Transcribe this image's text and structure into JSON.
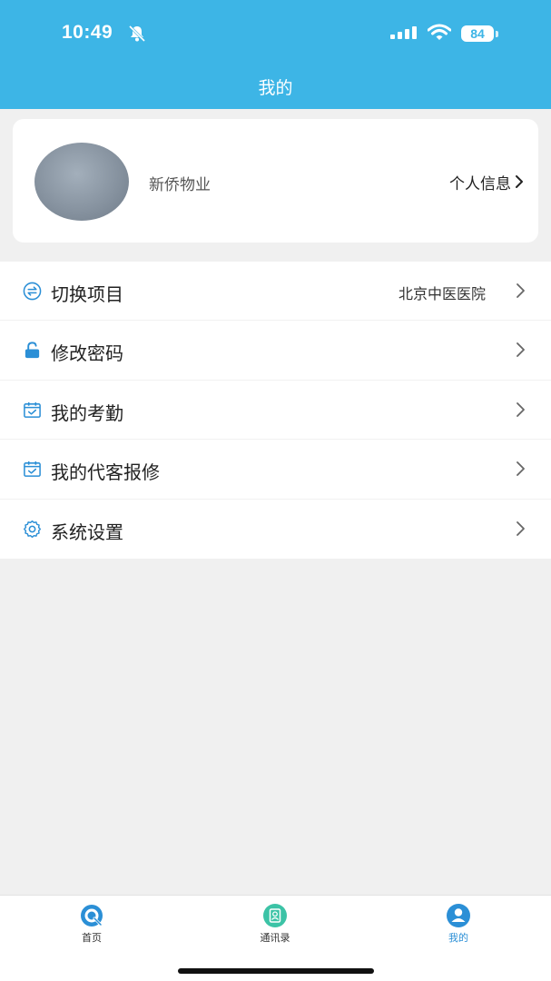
{
  "status_bar": {
    "time": "10:49",
    "battery": "84"
  },
  "header": {
    "title": "我的"
  },
  "profile": {
    "name": "新侨物业",
    "link_label": "个人信息"
  },
  "menu": {
    "items": [
      {
        "label": "切换项目",
        "value": "北京中医医院",
        "icon": "switch-icon"
      },
      {
        "label": "修改密码",
        "icon": "lock-icon"
      },
      {
        "label": "我的考勤",
        "icon": "calendar-check-icon"
      },
      {
        "label": "我的代客报修",
        "icon": "calendar-check-icon"
      },
      {
        "label": "系统设置",
        "icon": "gear-icon"
      }
    ]
  },
  "tabbar": {
    "tabs": [
      {
        "label": "首页",
        "icon": "home-q-icon"
      },
      {
        "label": "通讯录",
        "icon": "contacts-icon"
      },
      {
        "label": "我的",
        "icon": "user-icon"
      }
    ]
  },
  "colors": {
    "accent": "#3db5e6",
    "icon_blue": "#2b8fd6",
    "contacts_green": "#3cc3a6",
    "background": "#f0f0f0"
  }
}
